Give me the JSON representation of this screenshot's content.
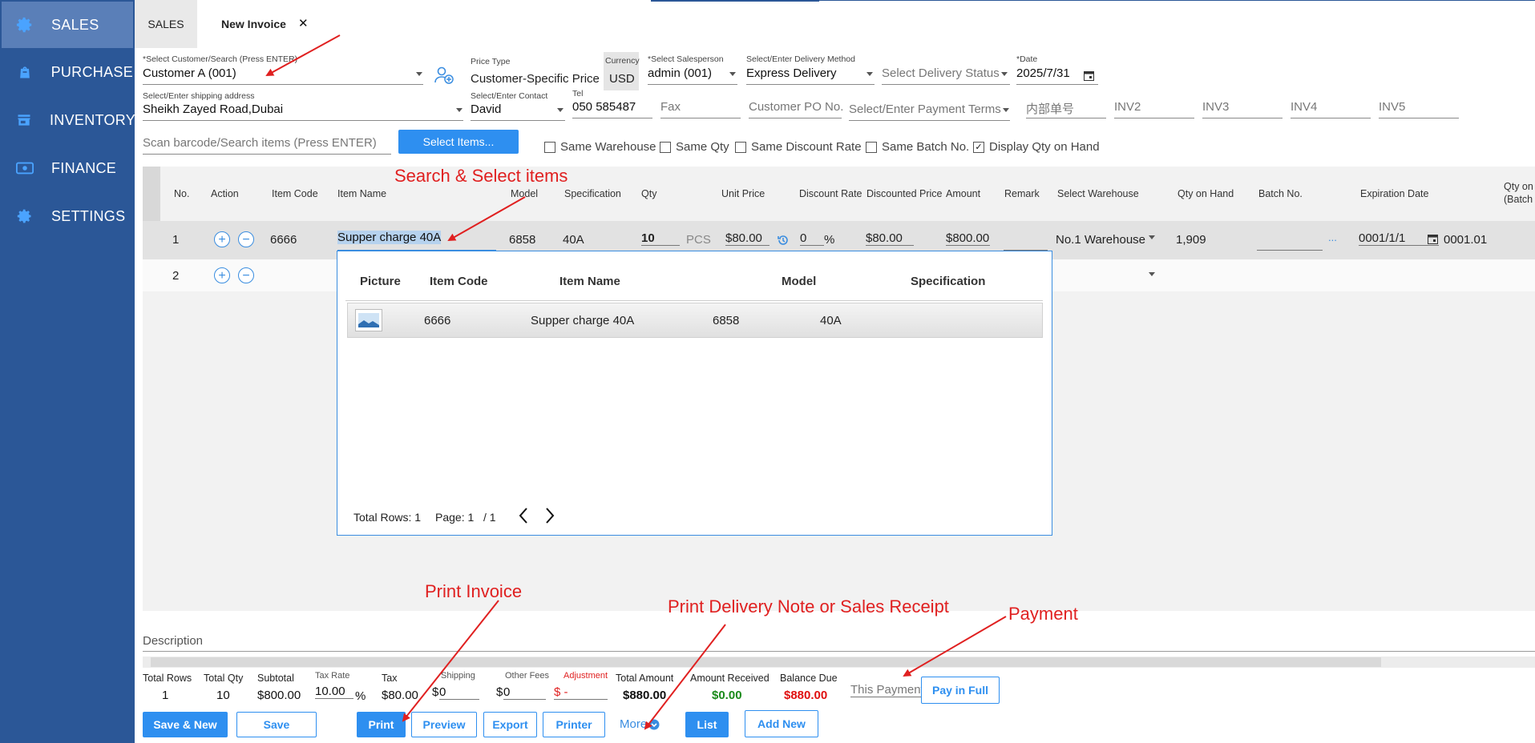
{
  "sidebar": {
    "items": [
      {
        "label": "SALES",
        "icon": "gear-icon"
      },
      {
        "label": "PURCHASE",
        "icon": "bag-icon"
      },
      {
        "label": "INVENTORY",
        "icon": "store-icon"
      },
      {
        "label": "FINANCE",
        "icon": "money-icon"
      },
      {
        "label": "SETTINGS",
        "icon": "gear-icon"
      }
    ]
  },
  "tabs": {
    "sales": "SALES",
    "invoice": "New Invoice",
    "close": "✕"
  },
  "form": {
    "customer_label": "*Select Customer/Search (Press ENTER)",
    "customer_value": "Customer A (001)",
    "price_type_label": "Price Type",
    "price_type_value": "Customer-Specific Price",
    "currency_label": "Currency",
    "currency_value": "USD",
    "salesperson_label": "*Select Salesperson",
    "salesperson_value": "admin (001)",
    "delivery_method_label": "Select/Enter Delivery Method",
    "delivery_method_value": "Express Delivery",
    "delivery_status_placeholder": "Select Delivery Status",
    "date_label": "*Date",
    "date_value": "2025/7/31",
    "shipping_label": "Select/Enter shipping address",
    "shipping_value": "Sheikh Zayed Road,Dubai",
    "contact_label": "Select/Enter Contact",
    "contact_value": "David",
    "tel_label": "Tel",
    "tel_value": "050 585487",
    "fax_placeholder": "Fax",
    "po_placeholder": "Customer PO No.",
    "payment_terms_placeholder": "Select/Enter Payment Terms",
    "internal_no_placeholder": "内部单号",
    "inv2": "INV2",
    "inv3": "INV3",
    "inv4": "INV4",
    "inv5": "INV5",
    "scan_placeholder": "Scan barcode/Search items (Press ENTER)",
    "select_items_btn": "Select Items...",
    "checkboxes": [
      {
        "label": "Same Warehouse",
        "checked": false
      },
      {
        "label": "Same Qty",
        "checked": false
      },
      {
        "label": "Same Discount Rate",
        "checked": false
      },
      {
        "label": "Same Batch No.",
        "checked": false
      },
      {
        "label": "Display Qty on Hand",
        "checked": true
      }
    ]
  },
  "table": {
    "headers": [
      "No.",
      "Action",
      "Item Code",
      "Item Name",
      "Model",
      "Specification",
      "Qty",
      "Unit Price",
      "Discount Rate",
      "Discounted Price",
      "Amount",
      "Remark",
      "Select Warehouse",
      "Qty on Hand",
      "Batch No.",
      "Expiration Date",
      "Qty on",
      "(Batch"
    ],
    "row1": {
      "no": "1",
      "code": "6666",
      "name": "Supper charge  40A",
      "model": "6858",
      "spec": "40A",
      "qty": "10",
      "unit": "PCS",
      "unit_price": "$80.00",
      "discount": "0",
      "pct": "%",
      "disc_price": "$80.00",
      "amount": "$800.00",
      "warehouse": "No.1 Warehouse",
      "qty_on_hand": "1,909",
      "batch_more": "...",
      "exp_date": "0001/1/1",
      "batch_qty": "0001.01"
    },
    "row2": {
      "no": "2"
    }
  },
  "popup": {
    "headers": [
      "Picture",
      "Item Code",
      "Item Name",
      "Model",
      "Specification"
    ],
    "row": {
      "code": "6666",
      "name": "Supper charge  40A",
      "model": "6858",
      "spec": "40A"
    },
    "total_rows": "Total Rows: 1",
    "page": "Page: 1",
    "page_total": "/ 1"
  },
  "annotations": {
    "search": "Search & Select items",
    "print_invoice": "Print Invoice",
    "print_delivery": "Print Delivery Note or Sales Receipt",
    "payment": "Payment"
  },
  "footer": {
    "description_label": "Description",
    "total_rows_label": "Total Rows",
    "total_rows": "1",
    "total_qty_label": "Total Qty",
    "total_qty": "10",
    "subtotal_label": "Subtotal",
    "subtotal": "$800.00",
    "tax_rate_label": "Tax Rate",
    "tax_rate": "10.00",
    "pct": "%",
    "tax_label": "Tax",
    "tax": "$80.00",
    "shipping_label": "Shipping",
    "shipping_cur": "$",
    "shipping": "0",
    "other_fees_label": "Other Fees",
    "other_cur": "$",
    "other_fees": "0",
    "adjustment_label": "Adjustment",
    "adjustment": "$ -",
    "total_amount_label": "Total Amount",
    "total_amount": "$880.00",
    "amount_received_label": "Amount Received",
    "amount_received": "$0.00",
    "balance_due_label": "Balance Due",
    "balance_due": "$880.00",
    "this_payment_placeholder": "This Payment",
    "pay_in_full": "Pay in Full"
  },
  "buttons": {
    "save_new": "Save & New",
    "save": "Save",
    "print": "Print",
    "preview": "Preview",
    "export": "Export",
    "printer": "Printer",
    "more": "More",
    "list": "List",
    "add_new": "Add New"
  },
  "colors": {
    "sidebar": "#2b5797",
    "accent": "#2e8ff0",
    "annotation": "#e02020",
    "received": "#1a8a1a",
    "due": "#e01010"
  }
}
